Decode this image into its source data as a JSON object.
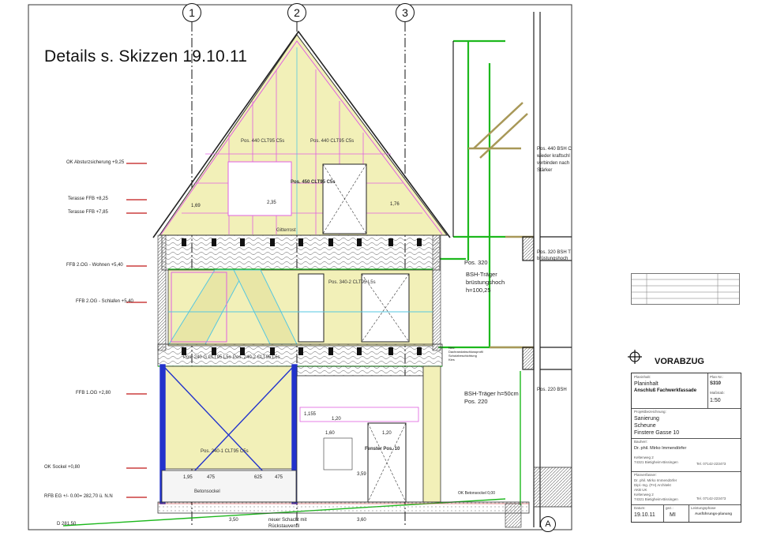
{
  "title": "Details s. Skizzen 19.10.11",
  "grid_axes": [
    "1",
    "2",
    "3",
    "A"
  ],
  "levels": [
    "OK Absturzsicherung +9,25",
    "Terasse FFB +8,25",
    "Terasse FFB +7,85",
    "FFB 2.OG - Wohnen +5,40",
    "FFB 2.OG - Schlafen +5,40",
    "FFB 1.OG +2,80",
    "OK Sockel +0,80",
    "RFB EG +/- 0.00= 282,70 ü. N.N"
  ],
  "bottom_left_label": "D 281,50",
  "elements": [
    "Pos. 440 CLT95 C5s",
    "Pos. 440 CLT95 C5s",
    "Pos. 450 CLT95 C5s",
    "Pos. 340-2 CLT95 L5s",
    "Pos. 240 G CLT95 L5s",
    "Pos. 240-2 CLT95 L5s",
    "Pos. 240-1 CLT95 C5s",
    "Fenster Pos. 10",
    "Betonsockel",
    "Gitterrost"
  ],
  "notes": {
    "pos320": "Pos. 320",
    "bsh_brust": "BSH-Träger",
    "bsh_brust2": "brüstungshoch",
    "bsh_h100": "h=100,25",
    "bsh_h50": "BSH-Träger h=50cm",
    "pos220": "Pos. 220",
    "right_pos440_1": "Pos. 440 BSH C",
    "right_pos440_2": "wieder kraftschl",
    "right_pos440_3": "verbinden nach",
    "right_pos440_4": "Stärker",
    "right_pos320_1": "Pos. 320 BSH T",
    "right_pos320_2": "brüstungshoch",
    "right_pos220": "Pos. 220 BSH",
    "ok_beton": "OK Betonsockel 0,00",
    "schacht_1": "neuer Schacht mit",
    "schacht_2": "Rückstauventil",
    "neu_1": "Neu:",
    "neu_2": "Dachrandabschlussprofil",
    "neu_3": "Schutzbeschichtung",
    "neu_4": "Kies"
  },
  "dimensions": [
    "3,50",
    "3,60",
    "1,95",
    "475",
    "625",
    "475",
    "1,60",
    "1,20",
    "1,20",
    "3,59",
    "1,155",
    "1,69",
    "1,76",
    "2,35"
  ],
  "vorabzug": "VORABZUG",
  "title_block": {
    "planinhalt_label": "Planinhalt:",
    "planinhalt_1": "Planinhalt",
    "planinhalt_2": "Anschluß Fachwerkfassade",
    "planno_label": "Plan Nr.:",
    "planno": "S310",
    "massstab_label": "Maßstab:",
    "massstab": "1:50",
    "projekt_label": "Projektbezeichnung:",
    "projekt_1": "Sanierung",
    "projekt_2": "Scheune",
    "projekt_3": "Finstere Gasse 10",
    "bauherr_label": "Bauherr:",
    "bauherr": "Dr. phil. Mirko Immendörfer",
    "bauherr_addr1": "Keltenweg 2",
    "bauherr_addr2": "74321 Bietigheim-Bissingen",
    "bauherr_tel": "Tel. 07142-223473",
    "planverfasser_label": "Planverfasser:",
    "planverfasser_1": "Dr. phil. Mirko Immendörfer",
    "planverfasser_2": "Dipl.-Ing. (FH) Architekt",
    "planverfasser_3": "AKB UK",
    "planverfasser_4": "Keltenweg 2",
    "planverfasser_5": "74321 Bietigheim-Bissingen",
    "planverfasser_tel": "Tel. 07142-223473",
    "datum_label": "Datum:",
    "datum": "19.10.11",
    "gez_label": "gez.:",
    "gez": "MI",
    "leistung_label": "Leistungsphase",
    "leistung": "Ausführungs-planung"
  },
  "colors": {
    "timber": "#f2f0b8",
    "green": "#1db81d",
    "magenta": "#e060e0",
    "blue": "#2233cc",
    "cyan": "#56c7e0",
    "red": "#c01818",
    "olive": "#a89858"
  }
}
